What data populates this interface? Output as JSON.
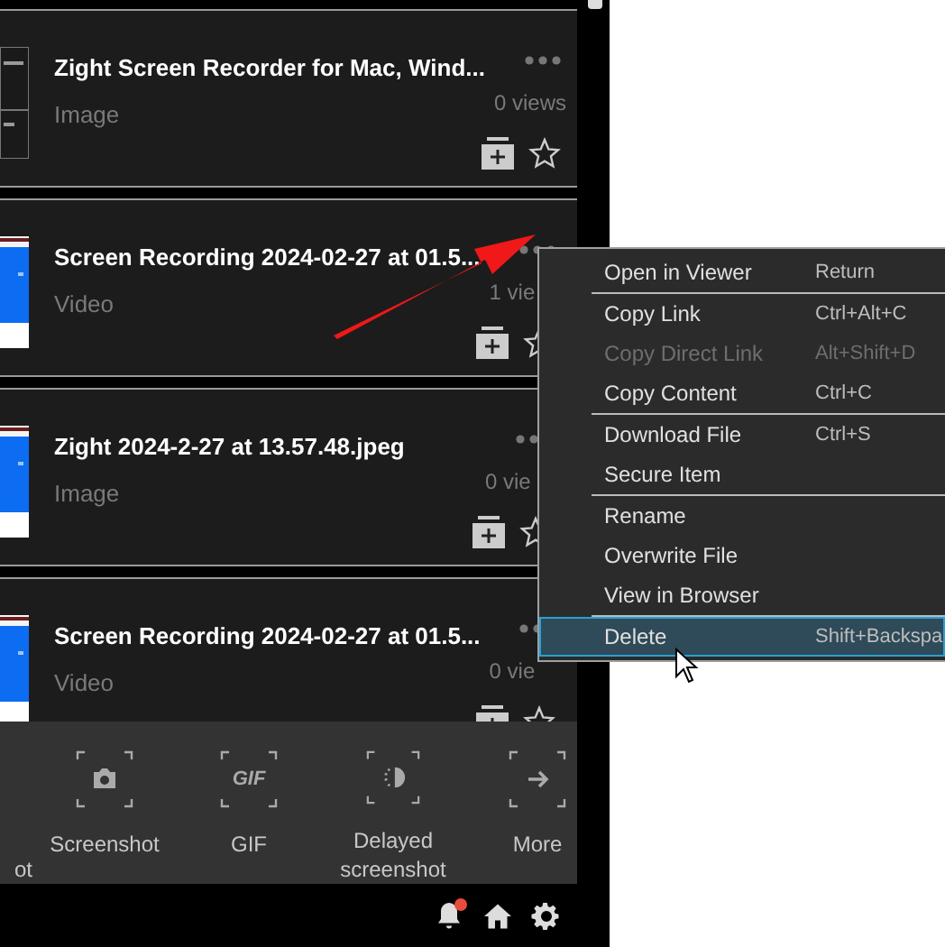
{
  "items": [
    {
      "title": "Zight Screen Recorder for Mac, Wind...",
      "type": "Image",
      "views": "0 views",
      "kind": "doc"
    },
    {
      "title": "Screen Recording 2024-02-27 at 01.5...",
      "type": "Video",
      "views": "1 vie",
      "kind": "blue"
    },
    {
      "title": "Zight 2024-2-27 at 13.57.48.jpeg",
      "type": "Image",
      "views": "0 vie",
      "kind": "blue"
    },
    {
      "title": "Screen Recording 2024-02-27 at 01.5...",
      "type": "Video",
      "views": "0 vie",
      "kind": "blue"
    }
  ],
  "context_menu": [
    {
      "kind": "item",
      "label": "Open in Viewer",
      "shortcut": "Return",
      "disabled": false,
      "selected": false
    },
    {
      "kind": "separator"
    },
    {
      "kind": "item",
      "label": "Copy Link",
      "shortcut": "Ctrl+Alt+C",
      "disabled": false,
      "selected": false
    },
    {
      "kind": "item",
      "label": "Copy Direct Link",
      "shortcut": "Alt+Shift+D",
      "disabled": true,
      "selected": false
    },
    {
      "kind": "item",
      "label": "Copy Content",
      "shortcut": "Ctrl+C",
      "disabled": false,
      "selected": false
    },
    {
      "kind": "separator"
    },
    {
      "kind": "item",
      "label": "Download File",
      "shortcut": "Ctrl+S",
      "disabled": false,
      "selected": false
    },
    {
      "kind": "item",
      "label": "Secure Item",
      "disabled": false,
      "selected": false
    },
    {
      "kind": "separator"
    },
    {
      "kind": "item",
      "label": "Rename",
      "disabled": false,
      "selected": false
    },
    {
      "kind": "item",
      "label": "Overwrite File",
      "disabled": false,
      "selected": false
    },
    {
      "kind": "item",
      "label": "View in Browser",
      "disabled": false,
      "selected": false
    },
    {
      "kind": "separator"
    },
    {
      "kind": "item",
      "label": "Delete",
      "shortcut": "Shift+Backspa",
      "disabled": false,
      "selected": true
    }
  ],
  "capture_toolbar": [
    {
      "kind": "cut",
      "label": "ot"
    },
    {
      "kind": "camera",
      "label": "Screenshot"
    },
    {
      "kind": "gif",
      "label": "GIF"
    },
    {
      "kind": "timer",
      "label": "Delayed screenshot"
    },
    {
      "kind": "arrow",
      "label": "More"
    }
  ],
  "gif_icon_text": "GIF",
  "footer": {
    "notification_badge": true
  }
}
